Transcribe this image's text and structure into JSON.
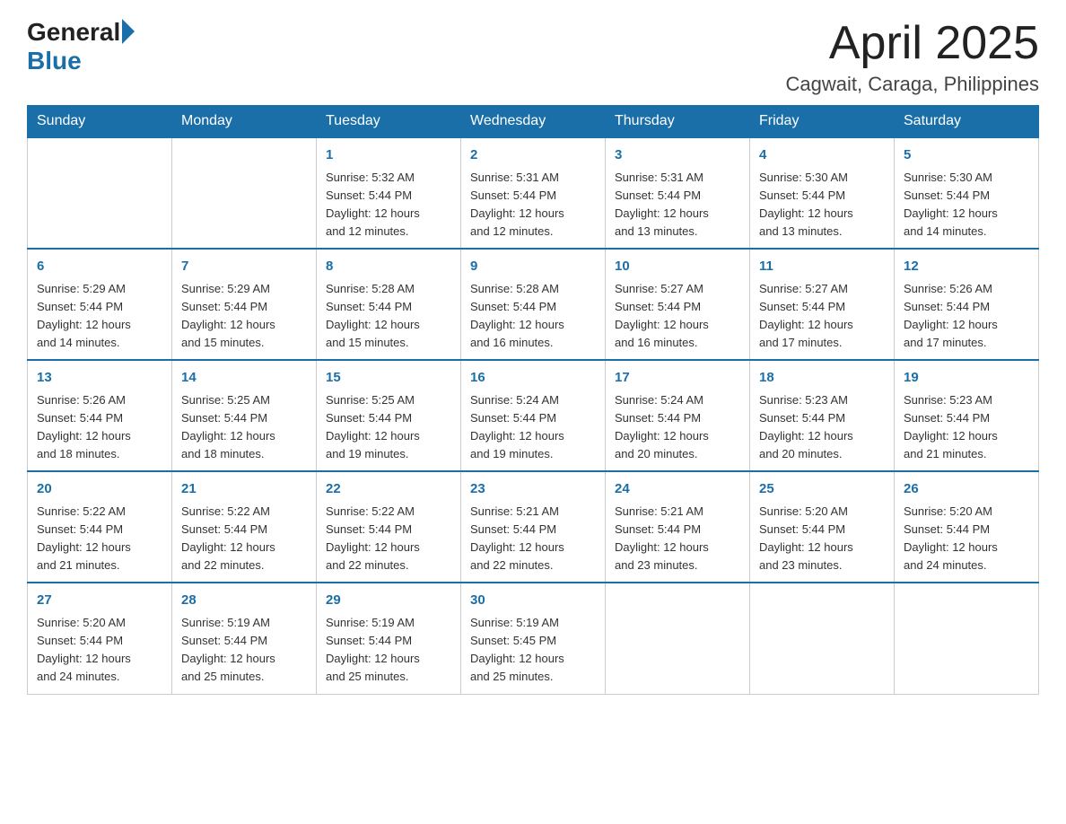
{
  "header": {
    "logo_text_general": "General",
    "logo_text_blue": "Blue",
    "month_title": "April 2025",
    "location": "Cagwait, Caraga, Philippines"
  },
  "days_of_week": [
    "Sunday",
    "Monday",
    "Tuesday",
    "Wednesday",
    "Thursday",
    "Friday",
    "Saturday"
  ],
  "weeks": [
    [
      {
        "day": "",
        "info": ""
      },
      {
        "day": "",
        "info": ""
      },
      {
        "day": "1",
        "info": "Sunrise: 5:32 AM\nSunset: 5:44 PM\nDaylight: 12 hours\nand 12 minutes."
      },
      {
        "day": "2",
        "info": "Sunrise: 5:31 AM\nSunset: 5:44 PM\nDaylight: 12 hours\nand 12 minutes."
      },
      {
        "day": "3",
        "info": "Sunrise: 5:31 AM\nSunset: 5:44 PM\nDaylight: 12 hours\nand 13 minutes."
      },
      {
        "day": "4",
        "info": "Sunrise: 5:30 AM\nSunset: 5:44 PM\nDaylight: 12 hours\nand 13 minutes."
      },
      {
        "day": "5",
        "info": "Sunrise: 5:30 AM\nSunset: 5:44 PM\nDaylight: 12 hours\nand 14 minutes."
      }
    ],
    [
      {
        "day": "6",
        "info": "Sunrise: 5:29 AM\nSunset: 5:44 PM\nDaylight: 12 hours\nand 14 minutes."
      },
      {
        "day": "7",
        "info": "Sunrise: 5:29 AM\nSunset: 5:44 PM\nDaylight: 12 hours\nand 15 minutes."
      },
      {
        "day": "8",
        "info": "Sunrise: 5:28 AM\nSunset: 5:44 PM\nDaylight: 12 hours\nand 15 minutes."
      },
      {
        "day": "9",
        "info": "Sunrise: 5:28 AM\nSunset: 5:44 PM\nDaylight: 12 hours\nand 16 minutes."
      },
      {
        "day": "10",
        "info": "Sunrise: 5:27 AM\nSunset: 5:44 PM\nDaylight: 12 hours\nand 16 minutes."
      },
      {
        "day": "11",
        "info": "Sunrise: 5:27 AM\nSunset: 5:44 PM\nDaylight: 12 hours\nand 17 minutes."
      },
      {
        "day": "12",
        "info": "Sunrise: 5:26 AM\nSunset: 5:44 PM\nDaylight: 12 hours\nand 17 minutes."
      }
    ],
    [
      {
        "day": "13",
        "info": "Sunrise: 5:26 AM\nSunset: 5:44 PM\nDaylight: 12 hours\nand 18 minutes."
      },
      {
        "day": "14",
        "info": "Sunrise: 5:25 AM\nSunset: 5:44 PM\nDaylight: 12 hours\nand 18 minutes."
      },
      {
        "day": "15",
        "info": "Sunrise: 5:25 AM\nSunset: 5:44 PM\nDaylight: 12 hours\nand 19 minutes."
      },
      {
        "day": "16",
        "info": "Sunrise: 5:24 AM\nSunset: 5:44 PM\nDaylight: 12 hours\nand 19 minutes."
      },
      {
        "day": "17",
        "info": "Sunrise: 5:24 AM\nSunset: 5:44 PM\nDaylight: 12 hours\nand 20 minutes."
      },
      {
        "day": "18",
        "info": "Sunrise: 5:23 AM\nSunset: 5:44 PM\nDaylight: 12 hours\nand 20 minutes."
      },
      {
        "day": "19",
        "info": "Sunrise: 5:23 AM\nSunset: 5:44 PM\nDaylight: 12 hours\nand 21 minutes."
      }
    ],
    [
      {
        "day": "20",
        "info": "Sunrise: 5:22 AM\nSunset: 5:44 PM\nDaylight: 12 hours\nand 21 minutes."
      },
      {
        "day": "21",
        "info": "Sunrise: 5:22 AM\nSunset: 5:44 PM\nDaylight: 12 hours\nand 22 minutes."
      },
      {
        "day": "22",
        "info": "Sunrise: 5:22 AM\nSunset: 5:44 PM\nDaylight: 12 hours\nand 22 minutes."
      },
      {
        "day": "23",
        "info": "Sunrise: 5:21 AM\nSunset: 5:44 PM\nDaylight: 12 hours\nand 22 minutes."
      },
      {
        "day": "24",
        "info": "Sunrise: 5:21 AM\nSunset: 5:44 PM\nDaylight: 12 hours\nand 23 minutes."
      },
      {
        "day": "25",
        "info": "Sunrise: 5:20 AM\nSunset: 5:44 PM\nDaylight: 12 hours\nand 23 minutes."
      },
      {
        "day": "26",
        "info": "Sunrise: 5:20 AM\nSunset: 5:44 PM\nDaylight: 12 hours\nand 24 minutes."
      }
    ],
    [
      {
        "day": "27",
        "info": "Sunrise: 5:20 AM\nSunset: 5:44 PM\nDaylight: 12 hours\nand 24 minutes."
      },
      {
        "day": "28",
        "info": "Sunrise: 5:19 AM\nSunset: 5:44 PM\nDaylight: 12 hours\nand 25 minutes."
      },
      {
        "day": "29",
        "info": "Sunrise: 5:19 AM\nSunset: 5:44 PM\nDaylight: 12 hours\nand 25 minutes."
      },
      {
        "day": "30",
        "info": "Sunrise: 5:19 AM\nSunset: 5:45 PM\nDaylight: 12 hours\nand 25 minutes."
      },
      {
        "day": "",
        "info": ""
      },
      {
        "day": "",
        "info": ""
      },
      {
        "day": "",
        "info": ""
      }
    ]
  ]
}
